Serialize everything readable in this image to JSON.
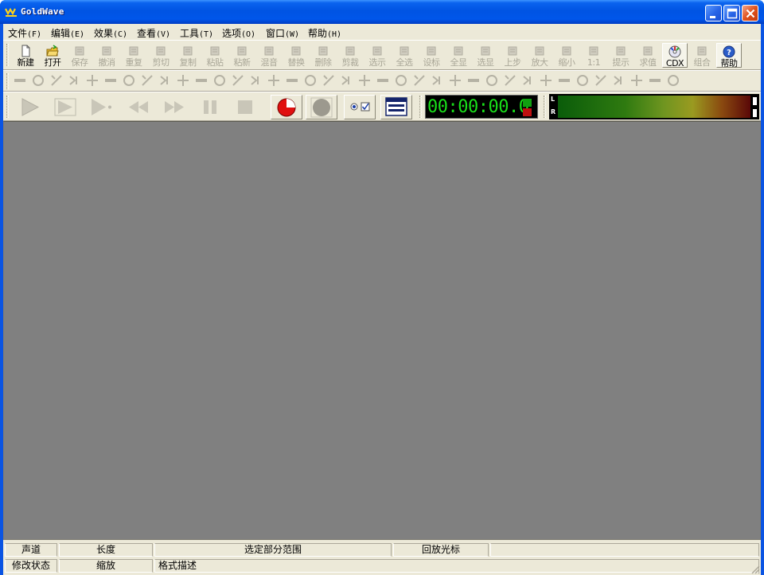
{
  "window": {
    "title": "GoldWave"
  },
  "menu": [
    {
      "label": "文件",
      "accel": "(F)"
    },
    {
      "label": "编辑",
      "accel": "(E)"
    },
    {
      "label": "效果",
      "accel": "(C)"
    },
    {
      "label": "查看",
      "accel": "(V)"
    },
    {
      "label": "工具",
      "accel": "(T)"
    },
    {
      "label": "选项",
      "accel": "(O)"
    },
    {
      "label": "窗口",
      "accel": "(W)"
    },
    {
      "label": "帮助",
      "accel": "(H)"
    }
  ],
  "toolbar": [
    {
      "label": "新建",
      "icon": "new-file-icon"
    },
    {
      "label": "打开",
      "icon": "open-folder-icon"
    },
    {
      "label": "保存",
      "icon": "save-icon"
    },
    {
      "label": "撤消",
      "icon": "undo-icon"
    },
    {
      "label": "重复",
      "icon": "redo-icon"
    },
    {
      "label": "剪切",
      "icon": "cut-icon"
    },
    {
      "label": "复制",
      "icon": "copy-icon"
    },
    {
      "label": "粘贴",
      "icon": "paste-icon"
    },
    {
      "label": "粘新",
      "icon": "paste-new-icon"
    },
    {
      "label": "混音",
      "icon": "mix-icon"
    },
    {
      "label": "替换",
      "icon": "replace-icon"
    },
    {
      "label": "删除",
      "icon": "delete-icon"
    },
    {
      "label": "剪裁",
      "icon": "trim-icon"
    },
    {
      "label": "选示",
      "icon": "select-view-icon"
    },
    {
      "label": "全选",
      "icon": "select-all-icon"
    },
    {
      "label": "设标",
      "icon": "set-marker-icon"
    },
    {
      "label": "全显",
      "icon": "zoom-all-icon"
    },
    {
      "label": "选显",
      "icon": "zoom-selection-icon"
    },
    {
      "label": "上步",
      "icon": "zoom-previous-icon"
    },
    {
      "label": "放大",
      "icon": "zoom-in-icon"
    },
    {
      "label": "缩小",
      "icon": "zoom-out-icon"
    },
    {
      "label": "1:1",
      "icon": "zoom-1to1-icon"
    },
    {
      "label": "提示",
      "icon": "cue-icon"
    },
    {
      "label": "求值",
      "icon": "expression-icon"
    },
    {
      "label": "CDX",
      "icon": "cd-extract-icon"
    },
    {
      "label": "组合",
      "icon": "combine-icon"
    },
    {
      "label": "帮助",
      "icon": "help-icon"
    }
  ],
  "effects_toolbar_count": 37,
  "control": {
    "time": "00:00:00.0",
    "meter_left_label": "L",
    "meter_right_label": "R"
  },
  "status": {
    "row1": [
      "声道",
      "长度",
      "选定部分范围",
      "回放光标"
    ],
    "row2": [
      "修改状态",
      "缩放",
      "格式描述"
    ]
  },
  "colors": {
    "workspace": "#808080",
    "chrome": "#ece9d8",
    "titlebar": "#0054e3",
    "timer_text": "#19e019"
  }
}
